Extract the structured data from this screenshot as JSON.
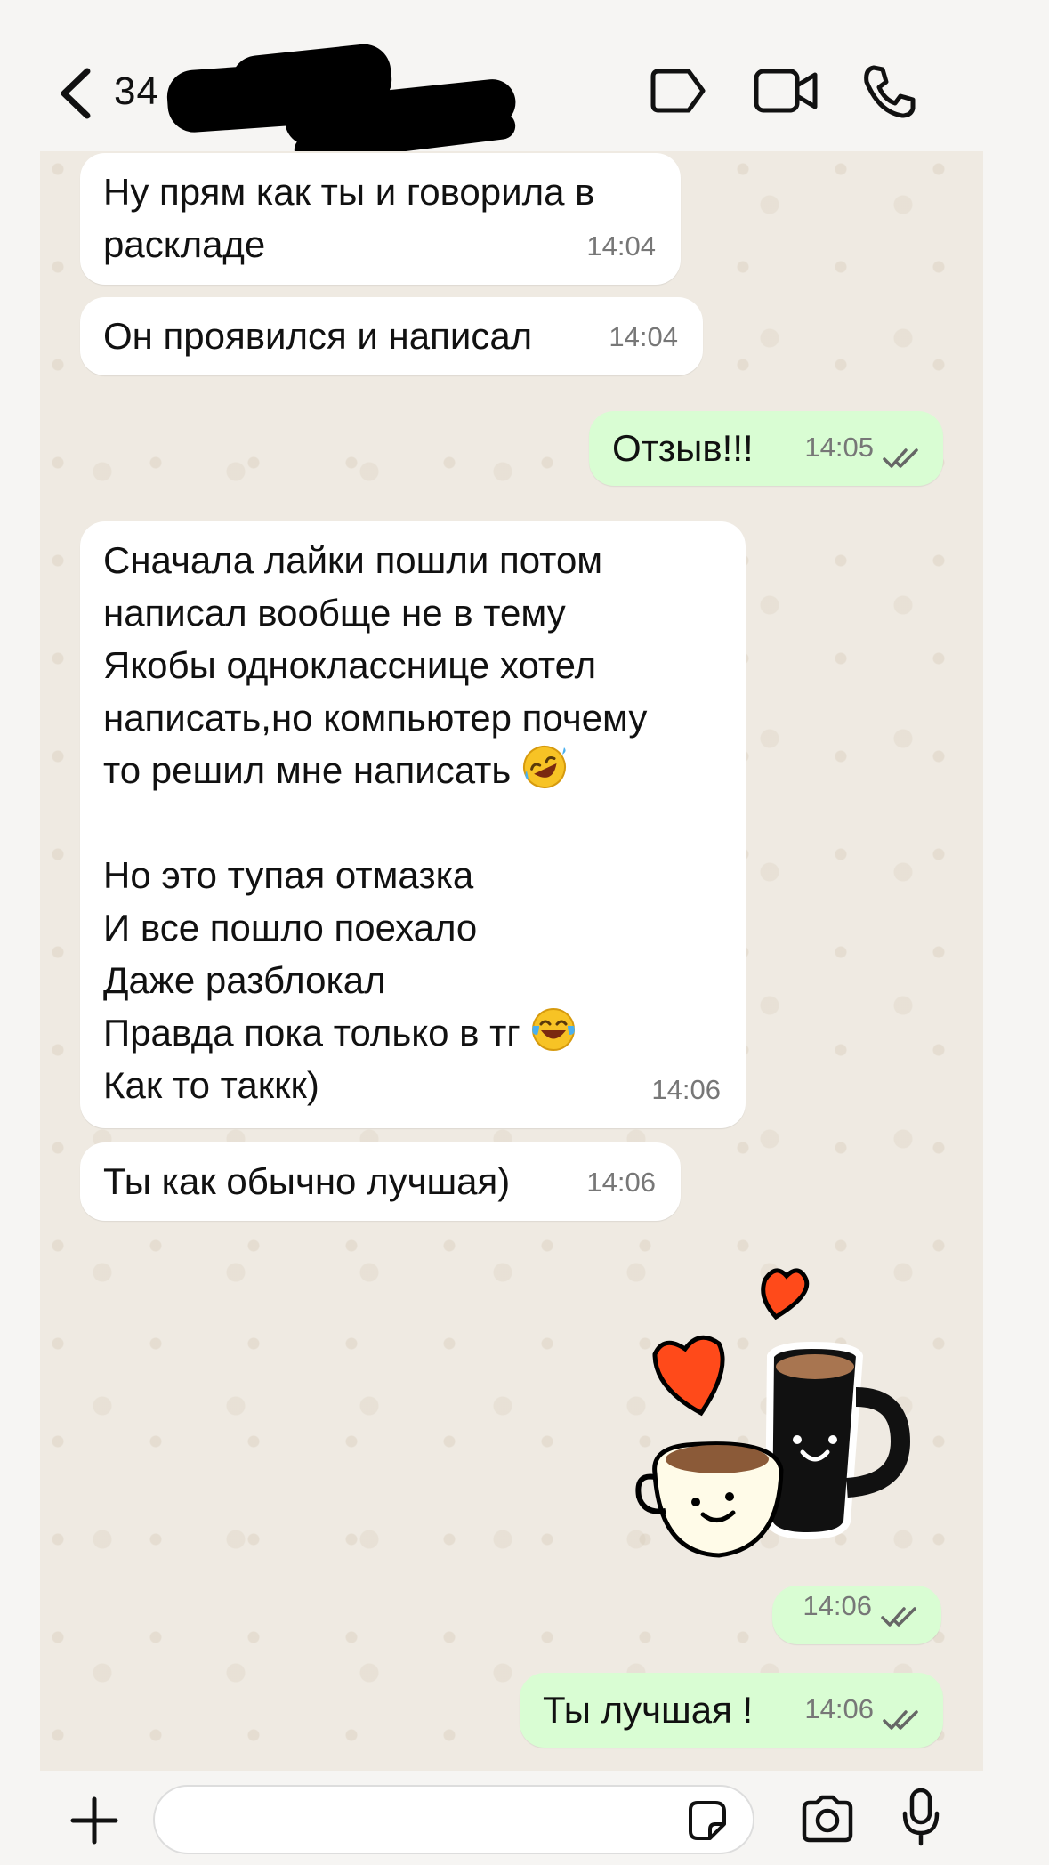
{
  "header": {
    "contact_name": "34",
    "icons": [
      "back-chevron-icon",
      "tag-label-icon",
      "video-call-icon",
      "voice-call-icon"
    ]
  },
  "messages": [
    {
      "dir": "in",
      "text": "Ну прям как ты и говорила в\nраскладе",
      "time": "14:04"
    },
    {
      "dir": "in",
      "text": "Он проявился и написал",
      "time": "14:04"
    },
    {
      "dir": "out",
      "text": "Отзыв!!!",
      "time": "14:05"
    },
    {
      "dir": "in",
      "text": "Сначала лайки пошли потом\nнаписал вообще не в тему\nЯкобы однокласснице хотел\nнаписать,но компьютер почему\nто решил мне написать",
      "emoji": "rolling-on-floor-laughing",
      "text2": "Но это тупая отмазка\nИ все пошло поехало\nДаже разблокал\nПравда пока только в тг",
      "emoji2": "face-with-tears-of-joy",
      "text3": "Как то таккк)",
      "time": "14:06"
    },
    {
      "dir": "in",
      "text": "Ты как обычно лучшая)",
      "time": "14:06"
    },
    {
      "dir": "out",
      "type": "sticker",
      "sticker": "coffee-cups-hearts",
      "time": "14:06"
    },
    {
      "dir": "out",
      "text": "Ты лучшая !",
      "time": "14:06"
    }
  ],
  "composer": {
    "placeholder": "",
    "icons": [
      "plus-icon",
      "sticker-icon",
      "camera-icon",
      "microphone-icon"
    ]
  },
  "colors": {
    "incoming": "#ffffff",
    "outgoing": "#d9fdd3",
    "chat_bg": "#efeae2",
    "timestamp": "#777777"
  }
}
